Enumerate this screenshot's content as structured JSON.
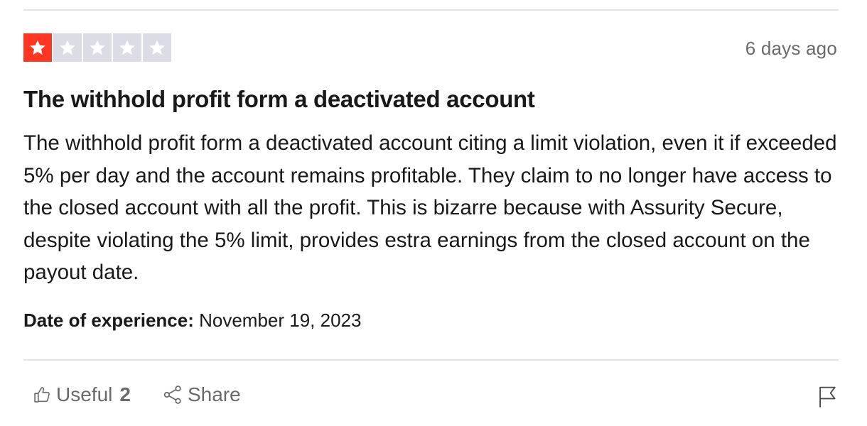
{
  "review": {
    "rating": 1,
    "rating_max": 5,
    "star_filled_color": "#ff3722",
    "star_empty_color": "#dcdce6",
    "date_ago": "6 days ago",
    "title": "The withhold profit form a deactivated account",
    "body": "The withhold profit form a deactivated account citing a limit violation, even it if exceeded 5% per day and the account remains profitable. They claim to no longer have access to the closed account with all the profit. This is bizarre because with Assurity Secure, despite violating the 5% limit, provides estra earnings from the closed account on the payout date.",
    "experience_label": "Date of experience:",
    "experience_date": "November 19, 2023"
  },
  "actions": {
    "useful_label": "Useful",
    "useful_count": "2",
    "useful_icon": "thumbs-up-icon",
    "share_label": "Share",
    "share_icon": "share-icon",
    "report_icon": "flag-icon"
  }
}
